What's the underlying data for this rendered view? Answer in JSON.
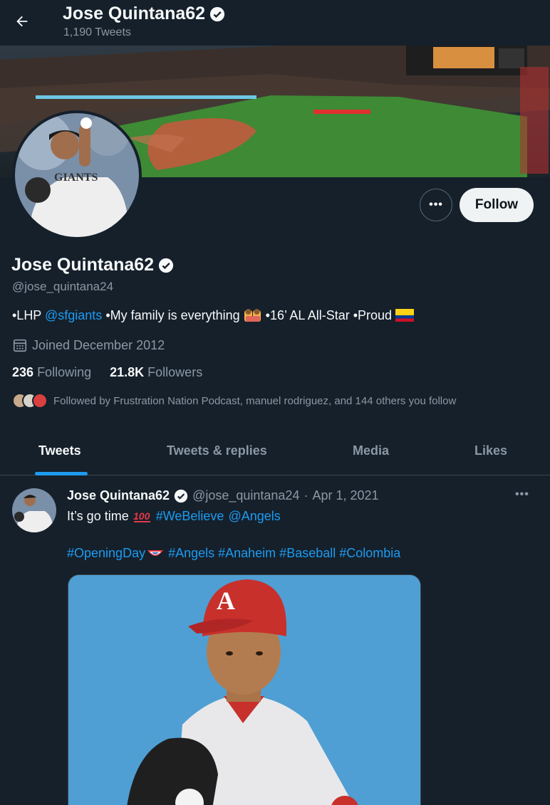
{
  "header": {
    "back_icon": "arrow-left-icon",
    "name": "Jose Quintana62",
    "tweet_count": "1,190 Tweets"
  },
  "profile": {
    "name": "Jose Quintana62",
    "handle": "@jose_quintana24",
    "bio": {
      "part1": "•LHP ",
      "mention": "@sfgiants",
      "part2": " •My family is everything ",
      "part3": " •16’ AL All-Star •Proud "
    },
    "joined": "Joined December 2012",
    "following_count": "236",
    "following_label": "Following",
    "followers_count": "21.8K",
    "followers_label": "Followers",
    "followed_by": "Followed by Frustration Nation Podcast, manuel rodriguez, and 144 others you follow"
  },
  "actions": {
    "more_label": "•••",
    "follow_label": "Follow"
  },
  "tabs": [
    {
      "label": "Tweets",
      "active": true
    },
    {
      "label": "Tweets & replies",
      "active": false
    },
    {
      "label": "Media",
      "active": false
    },
    {
      "label": "Likes",
      "active": false
    }
  ],
  "tweet": {
    "name": "Jose Quintana62",
    "handle": "@jose_quintana24",
    "separator": "·",
    "date": "Apr 1, 2021",
    "more_label": "•••",
    "text_start": "It’s go time",
    "hashtag1": "#WeBelieve",
    "mention1": "@Angels",
    "hashtag_opening": "#OpeningDay",
    "hashtags_rest": "#Angels #Anaheim #Baseball #Colombia"
  },
  "colors": {
    "background": "#15202b",
    "accent": "#1d9bf0",
    "muted": "#8b98a5"
  }
}
